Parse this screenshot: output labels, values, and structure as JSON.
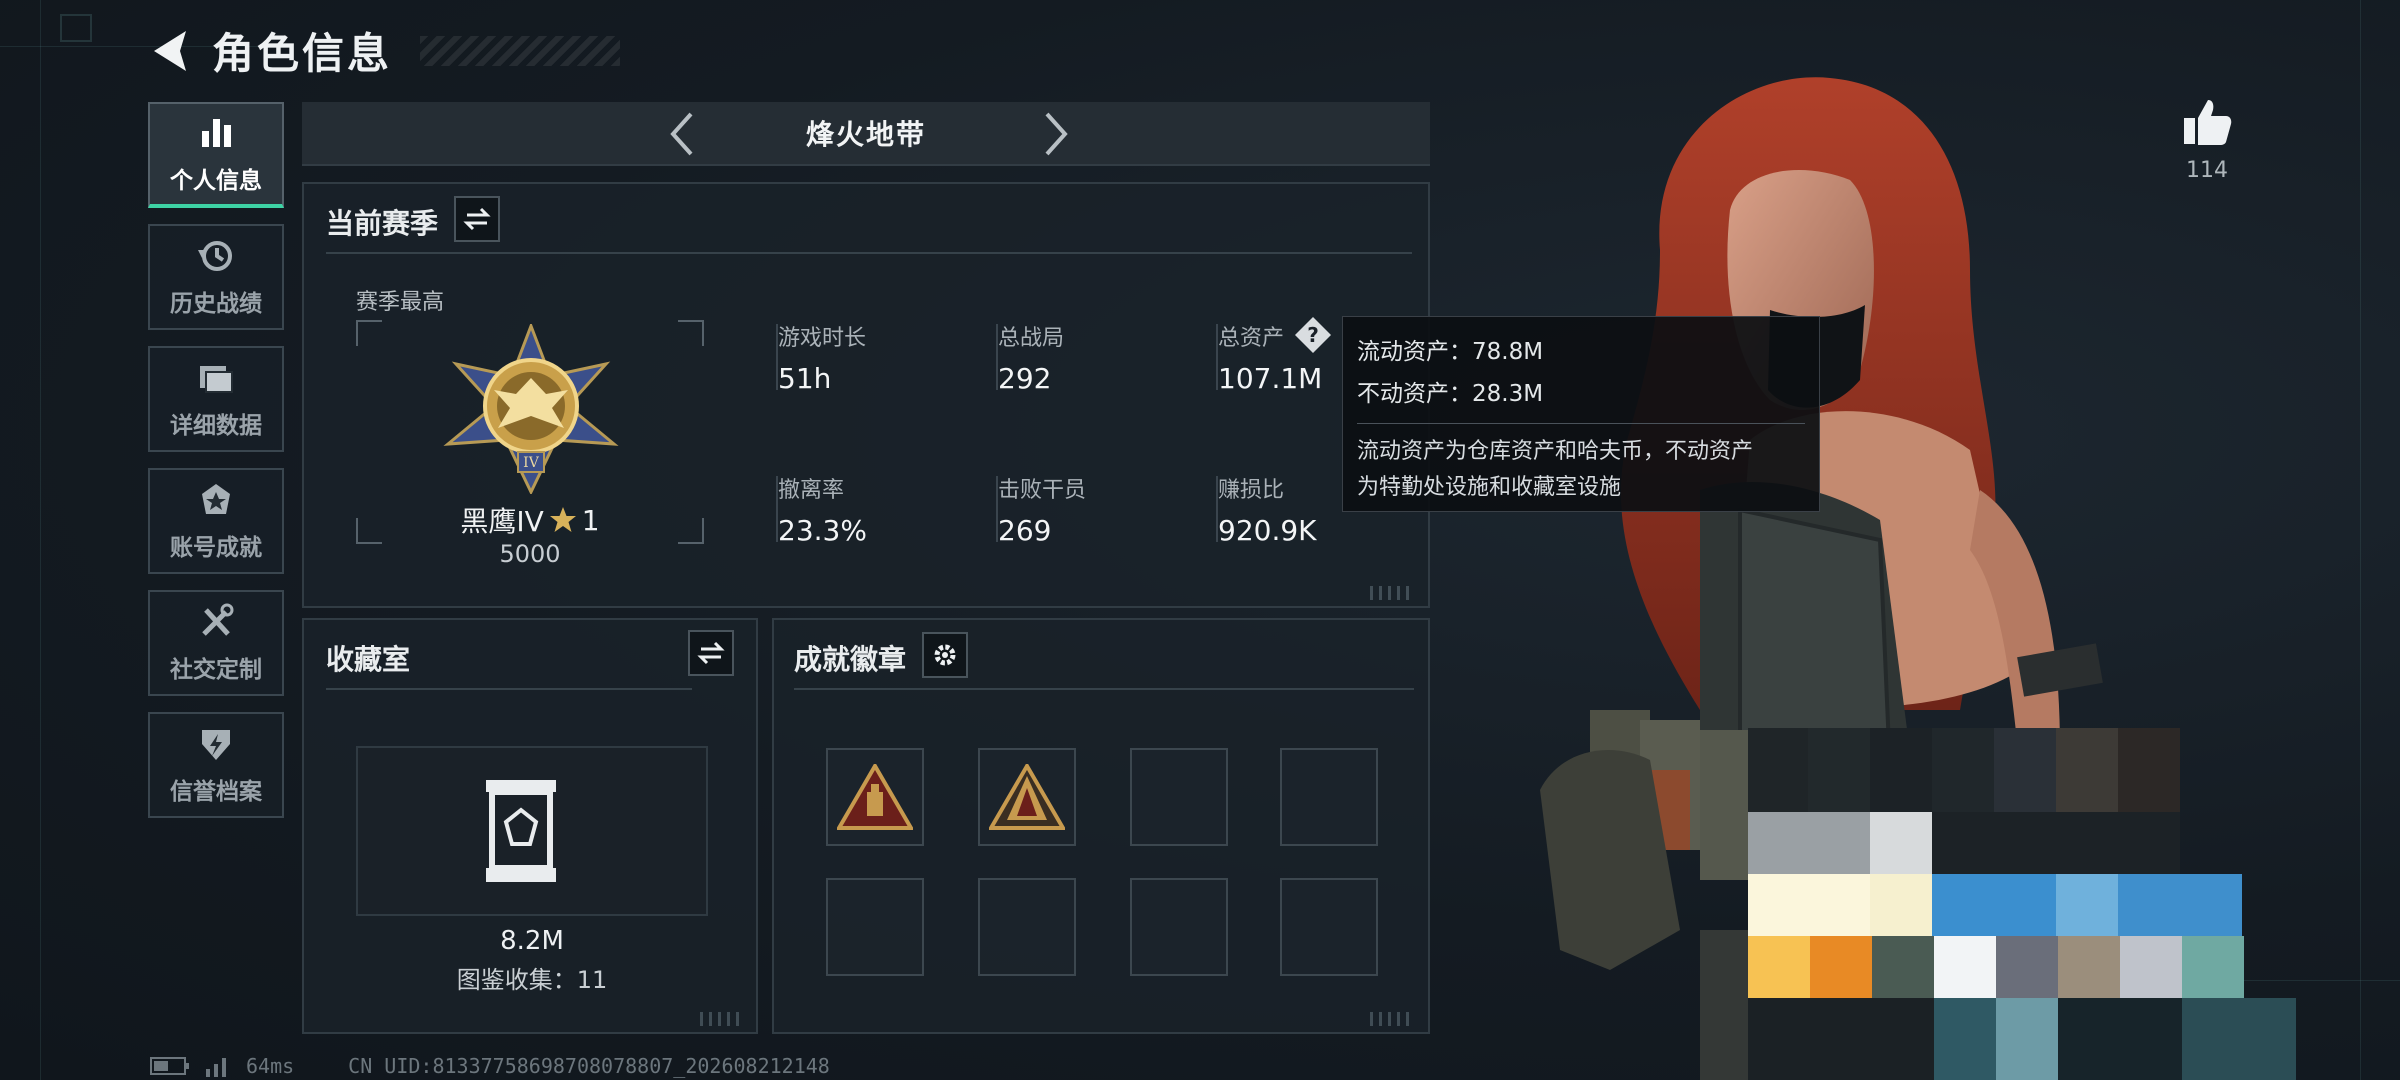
{
  "header": {
    "title": "角色信息"
  },
  "sidebar": {
    "items": [
      {
        "label": "个人信息",
        "icon": "bar-chart-icon",
        "active": true
      },
      {
        "label": "历史战绩",
        "icon": "history-icon"
      },
      {
        "label": "详细数据",
        "icon": "folder-icon"
      },
      {
        "label": "账号成就",
        "icon": "achievement-icon"
      },
      {
        "label": "社交定制",
        "icon": "tools-icon"
      },
      {
        "label": "信誉档案",
        "icon": "reputation-icon"
      }
    ]
  },
  "mode": {
    "name": "烽火地带"
  },
  "season": {
    "title": "当前赛季",
    "best_label": "赛季最高",
    "rank_name": "黑鹰IV",
    "rank_stars": "1",
    "rank_score": "5000",
    "stats": [
      {
        "label": "游戏时长",
        "value": "51h"
      },
      {
        "label": "总战局",
        "value": "292"
      },
      {
        "label": "总资产",
        "value": "107.1M"
      },
      {
        "label": "撤离率",
        "value": "23.3%"
      },
      {
        "label": "击败干员",
        "value": "269"
      },
      {
        "label": "赚损比",
        "value": "920.9K"
      }
    ]
  },
  "tooltip": {
    "liquid": "流动资产：78.8M",
    "fixed": "不动资产：28.3M",
    "note_line1": "流动资产为仓库资产和哈夫币，不动资产",
    "note_line2": "为特勤处设施和收藏室设施"
  },
  "collection": {
    "title": "收藏室",
    "value": "8.2M",
    "count": "图鉴收集：11"
  },
  "achievements": {
    "title": "成就徽章",
    "slots": [
      {
        "filled": true,
        "badge": "triangle-badge-icon"
      },
      {
        "filled": true,
        "badge": "triangle-badge-icon"
      },
      {
        "filled": false
      },
      {
        "filled": false
      },
      {
        "filled": false
      },
      {
        "filled": false
      },
      {
        "filled": false
      },
      {
        "filled": false
      }
    ]
  },
  "social": {
    "likes": "114"
  },
  "status": {
    "ping": "64ms",
    "uid": "CN UID:8133775869870807880​7_202608212148"
  },
  "colors": {
    "accent": "#3ed3a5",
    "gold": "#d8b25a",
    "panel": "#1a2229"
  }
}
